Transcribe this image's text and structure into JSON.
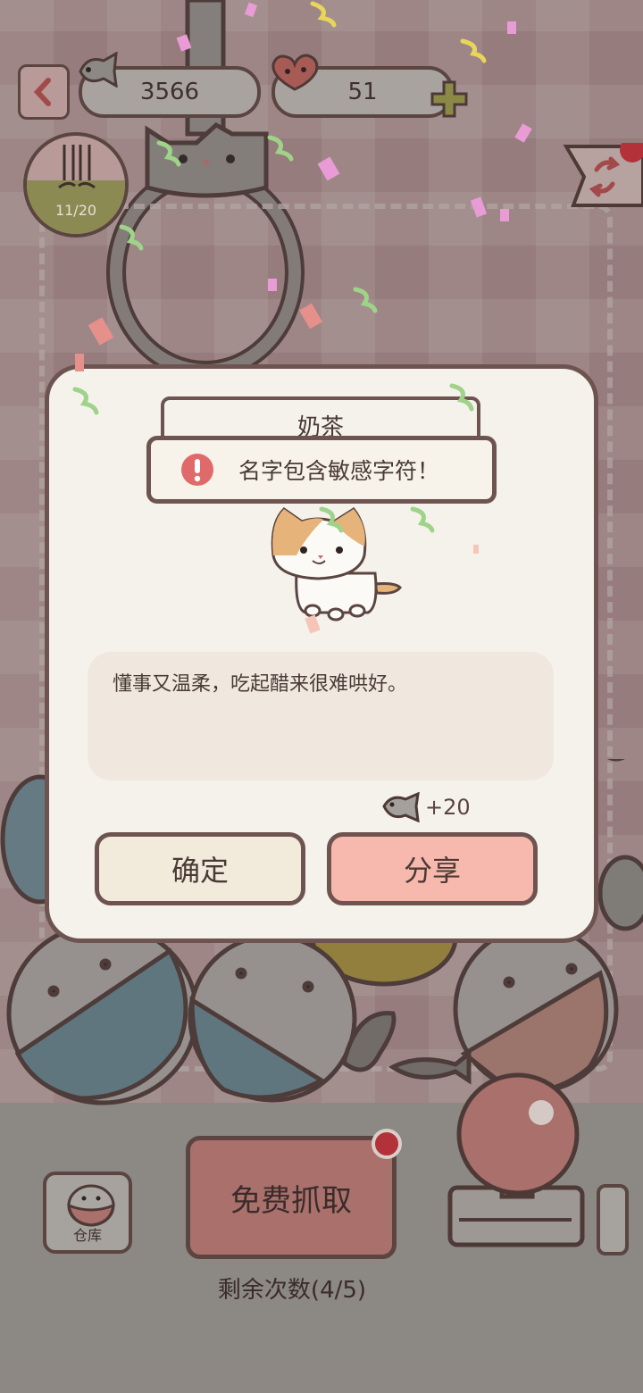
{
  "hud": {
    "fish_count": "3566",
    "heart_count": "51",
    "progress_label": "11/20",
    "progress_fraction": 0.55
  },
  "dialog": {
    "cat_name": "奶茶",
    "toast_message": "名字包含敏感字符！",
    "description": "懂事又温柔，吃起醋来很难哄好。",
    "reward": "+20",
    "confirm_label": "确定",
    "share_label": "分享"
  },
  "controls": {
    "warehouse_label": "仓库",
    "grab_label": "免费抓取",
    "remaining_label": "剩余次数(4/5)"
  },
  "colors": {
    "outline": "#5b4540",
    "share_button": "#f7b9ad",
    "confirm_button": "#f2eadb",
    "grab_button": "#a9706c",
    "alert_red": "#e06a6a"
  },
  "icons": [
    "back-arrow-icon",
    "fish-icon",
    "heart-icon",
    "plus-icon",
    "share-icon",
    "alert-icon",
    "warehouse-icon"
  ]
}
